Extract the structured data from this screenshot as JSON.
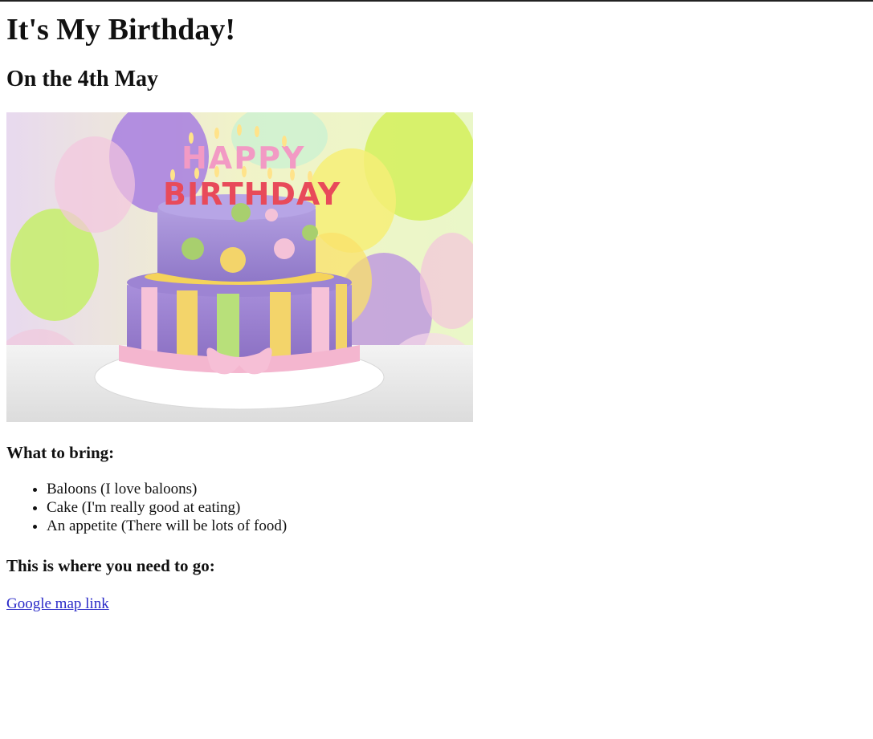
{
  "page": {
    "title": "It's My Birthday!",
    "subtitle": "On the 4th May",
    "image_subject": "birthday-cake-photo",
    "cake_candles_text": "HAPPY BIRTHDAY",
    "bring_heading": "What to bring:",
    "bring_items": [
      "Baloons (I love baloons)",
      "Cake (I'm really good at eating)",
      "An appetite (There will be lots of food)"
    ],
    "location_heading": "This is where you need to go:",
    "map_link_text": "Google map link"
  },
  "colors": {
    "link": "#2a2ac8",
    "text": "#111111",
    "background": "#ffffff"
  }
}
